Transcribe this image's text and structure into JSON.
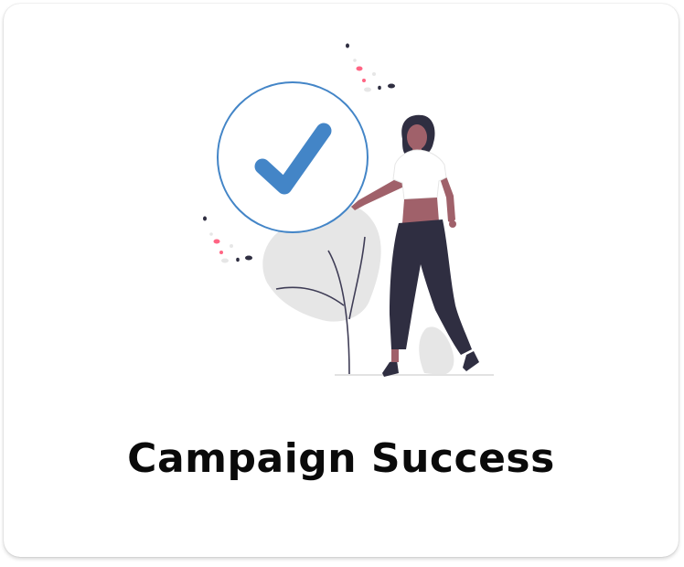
{
  "card": {
    "title": "Campaign Success",
    "illustration_icon": "checkmark-circle-icon"
  },
  "colors": {
    "accent": "#4385c7",
    "skin": "#a0616a",
    "pants": "#2f2e41",
    "shirt": "#ffffff",
    "foliage": "#e6e6e6",
    "confetti_pink": "#ff6584",
    "text": "#0a0a0a"
  }
}
